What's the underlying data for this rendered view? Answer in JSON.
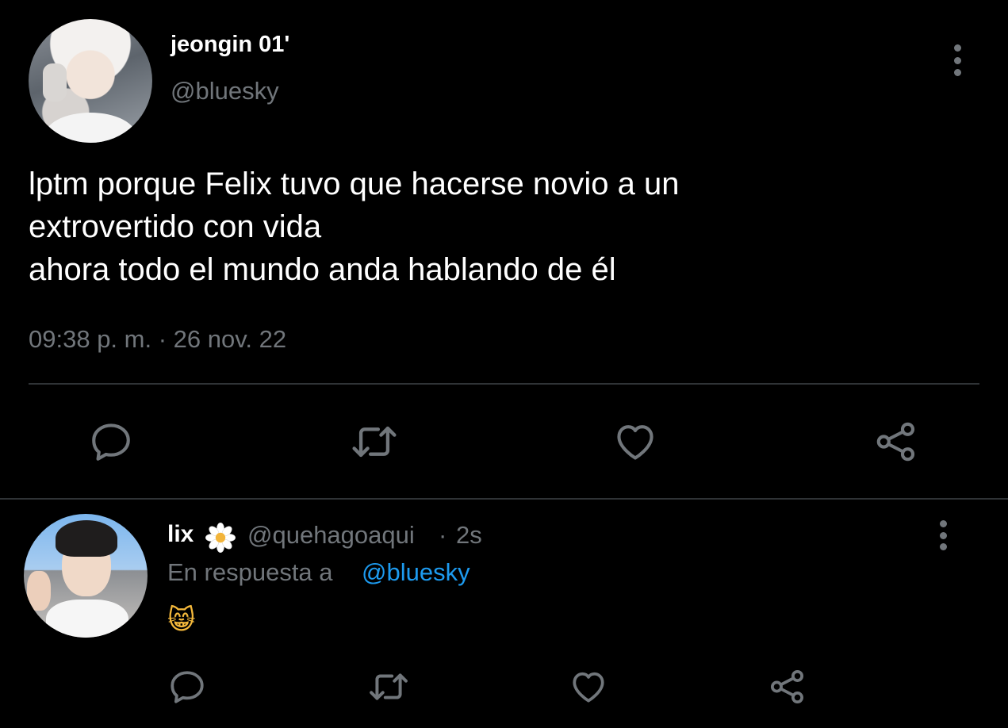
{
  "theme": {
    "background": "#000000",
    "text": "#ffffff",
    "muted": "#71767b",
    "link": "#1d9bf0",
    "divider": "#2f3336"
  },
  "tweet": {
    "author": {
      "display_name": "jeongin 01'",
      "handle": "@bluesky"
    },
    "text_lines": [
      "lptm porque Felix tuvo que hacerse novio a un",
      "extrovertido con vida",
      "ahora todo el mundo anda hablando de él"
    ],
    "timestamp": "09:38 p. m. · 26 nov. 22",
    "actions": [
      "reply-icon",
      "retweet-icon",
      "like-icon",
      "share-icon"
    ]
  },
  "reply": {
    "author": {
      "display_name": "lix",
      "badge_icon": "daisy-flower-icon",
      "handle": "@quehagoaqui",
      "separator": "·",
      "time": "2s"
    },
    "replying_to_prefix": "En respuesta a",
    "replying_to_handle": "@bluesky",
    "text": "😸",
    "actions": [
      "reply-icon",
      "retweet-icon",
      "like-icon",
      "share-icon"
    ]
  }
}
